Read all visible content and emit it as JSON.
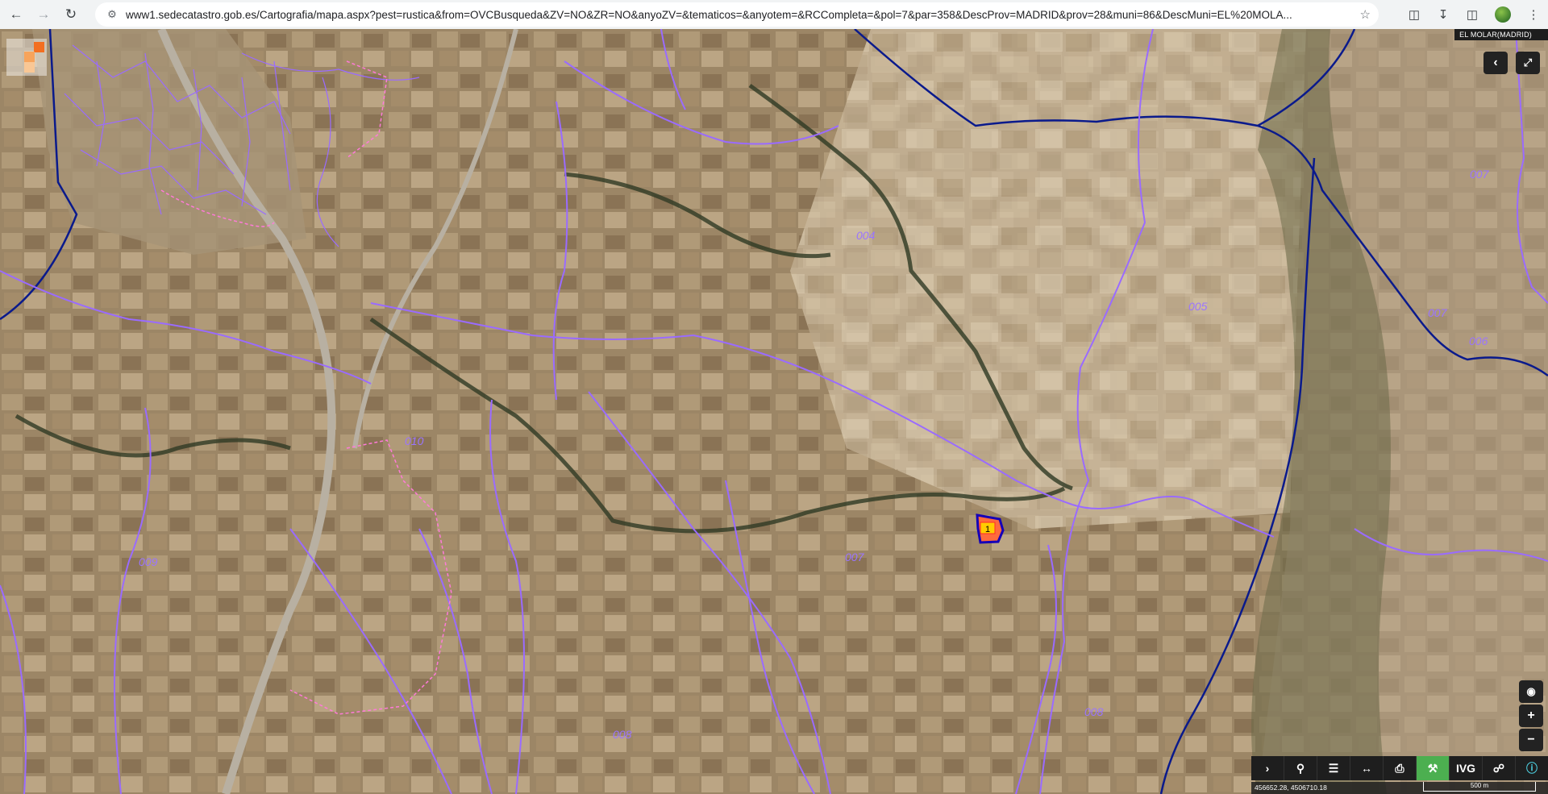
{
  "browser": {
    "url": "www1.sedecatastro.gob.es/Cartografia/mapa.aspx?pest=rustica&from=OVCBusqueda&ZV=NO&ZR=NO&anyoZV=&tematicos=&anyotem=&RCCompleta=&pol=7&par=358&DescProv=MADRID&prov=28&muni=86&DescMuni=EL%20MOLA..."
  },
  "map": {
    "municipality_label": "EL MOLAR(MADRID)",
    "polygon_labels": [
      "004",
      "005",
      "007",
      "007",
      "007",
      "008",
      "008",
      "006",
      "009",
      "010"
    ],
    "parcel_marker": "1",
    "coordinates": "456652.28, 4506710.18",
    "scale_label": "500 m"
  },
  "toolbar": {
    "ivg_label": "IVG"
  },
  "icons": {
    "back": "back-arrow-icon",
    "forward": "forward-arrow-icon",
    "reload": "reload-icon",
    "site_info": "site-info-icon",
    "bookmark": "star-icon",
    "extensions": "puzzle-icon",
    "download": "download-icon",
    "sidepanel": "sidepanel-icon"
  },
  "colors": {
    "parcel_boundary": "#9a6bff",
    "municipal_boundary": "#0a1a8c",
    "urban_boundary": "#ff7ad9",
    "selected_parcel_fill": "#ffcc00",
    "selected_parcel_border": "#ff2a2a",
    "toolbar_active": "#4caf50"
  }
}
